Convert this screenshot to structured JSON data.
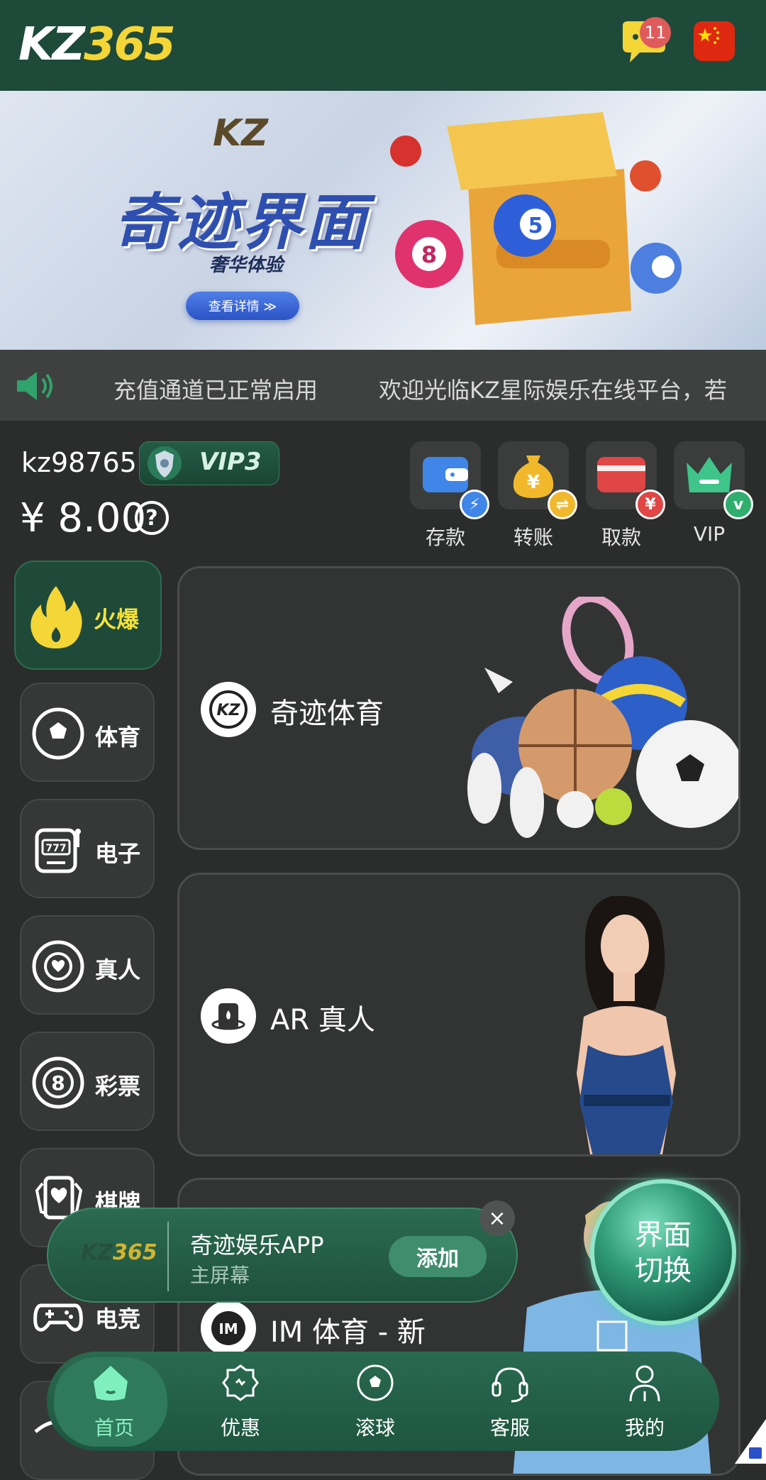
{
  "header": {
    "logo_kz": "KZ",
    "logo_num": "365",
    "message_count": "11"
  },
  "banner": {
    "brand": "KZ",
    "title": "奇迹界面",
    "subtitle": "奢华体验",
    "button": "查看详情 ≫",
    "slide_index": 1,
    "slide_total": 2
  },
  "marquee": {
    "text1": "充值通道已正常启用",
    "text2": "欢迎光临KZ星际娱乐在线平台，若"
  },
  "account": {
    "username": "kz98765",
    "vip_level": "VIP3",
    "balance": "¥ 8.00",
    "help_symbol": "?"
  },
  "quick_actions": [
    {
      "label": "存款",
      "icon": "wallet-icon",
      "badge": "⚡"
    },
    {
      "label": "转账",
      "icon": "money-bag-icon",
      "badge": "⇌"
    },
    {
      "label": "取款",
      "icon": "card-icon",
      "badge": "¥"
    },
    {
      "label": "VIP",
      "icon": "crown-icon",
      "badge": "v"
    }
  ],
  "categories": [
    {
      "label": "火爆",
      "icon": "flame-icon"
    },
    {
      "label": "体育",
      "icon": "soccer-ball-icon"
    },
    {
      "label": "电子",
      "icon": "slot-machine-icon"
    },
    {
      "label": "真人",
      "icon": "poker-chip-icon"
    },
    {
      "label": "彩票",
      "icon": "lottery-ball-icon"
    },
    {
      "label": "棋牌",
      "icon": "playing-cards-icon"
    },
    {
      "label": "电竞",
      "icon": "gamepad-icon"
    }
  ],
  "cards": [
    {
      "title": "奇迹体育"
    },
    {
      "title": "AR 真人"
    },
    {
      "title": "IM 体育 - 新"
    }
  ],
  "install_prompt": {
    "logo_kz": "KZ",
    "logo_num": "365",
    "title": "奇迹娱乐APP",
    "subtitle": "主屏幕",
    "button": "添加",
    "close": "×"
  },
  "switch_button": {
    "line1": "界面",
    "line2": "切换"
  },
  "tabbar": [
    {
      "label": "首页",
      "icon": "home-icon"
    },
    {
      "label": "优惠",
      "icon": "gift-icon"
    },
    {
      "label": "滚球",
      "icon": "ball-icon"
    },
    {
      "label": "客服",
      "icon": "headset-icon"
    },
    {
      "label": "我的",
      "icon": "user-icon"
    }
  ],
  "colors": {
    "header_bg": "#1e4a3a",
    "accent_yellow": "#f4d637",
    "accent_green": "#2f7a5c"
  }
}
